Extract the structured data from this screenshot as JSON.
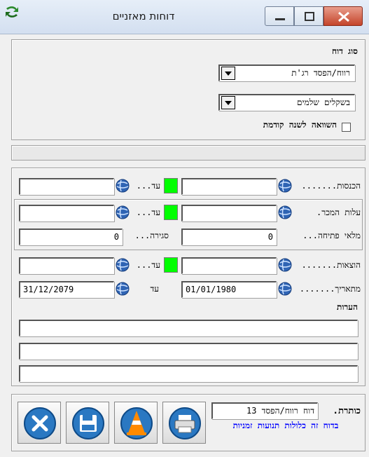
{
  "window": {
    "title": "דוחות מאזניים",
    "controls": [
      "minimize-icon",
      "maximize-icon",
      "close-icon"
    ]
  },
  "report_type": {
    "label": "סוג דוח",
    "report_select": "רווח/הפסד רג'ת",
    "currency_select": "בשקלים שלמים",
    "compare_label": "השוואה לשנה קודמת",
    "compare_checked": false
  },
  "status_bar": {
    "text": ""
  },
  "ranges": {
    "income": {
      "label": "הכנסות.......",
      "to_label": "עד...",
      "from_value": "",
      "to_value": ""
    },
    "cost_of_sales": {
      "label": "עלות המכר.",
      "to_label": "עד...",
      "from_value": "",
      "to_value": ""
    },
    "inventory": {
      "opening_label": "מלאי פתיחה...",
      "closing_label": "סגירה...",
      "opening_value": "0",
      "closing_value": "0"
    },
    "expenses": {
      "label": "הוצאות.......",
      "to_label": "עד...",
      "from_value": "",
      "to_value": ""
    },
    "dates": {
      "from_label": "מתאריך.......",
      "to_label": "עד",
      "from_value": "01/01/1980",
      "to_value": "31/12/2079"
    },
    "notes_label": "הערות",
    "notes": [
      "",
      "",
      ""
    ]
  },
  "footer": {
    "heading_label": "כותרת.",
    "heading_value": "דוח רווח/הפסד 13",
    "notice": "בדוח זה כלולות תנועות זמניות",
    "buttons": [
      {
        "name": "close-button",
        "icon": "x-circle-icon"
      },
      {
        "name": "save-button",
        "icon": "floppy-disk-icon"
      },
      {
        "name": "vlc-button",
        "icon": "cone-icon"
      },
      {
        "name": "print-button",
        "icon": "printer-icon"
      }
    ]
  },
  "colors": {
    "accent_green": "#00ff00",
    "notice_blue": "#0000ff",
    "close_red": "#c4442a",
    "globe_blue": "#2f64b4"
  }
}
